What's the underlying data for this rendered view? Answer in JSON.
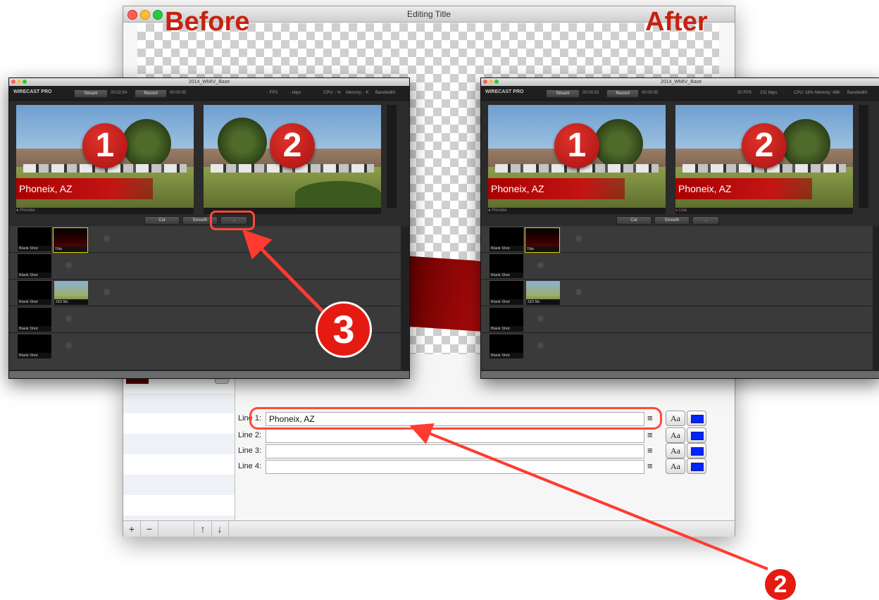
{
  "editing_window": {
    "title": "Editing Title",
    "before_label": "Before",
    "after_label": "After",
    "lines": [
      {
        "label": "Line 1:",
        "value": "Phoneix, AZ"
      },
      {
        "label": "Line 2:",
        "value": ""
      },
      {
        "label": "Line 3:",
        "value": ""
      },
      {
        "label": "Line 4:",
        "value": ""
      }
    ],
    "font_button": "Aa",
    "align_glyph": "≡",
    "color_swatch": "#0024ff",
    "bottom_buttons": {
      "add": "+",
      "remove": "−",
      "up": "↑",
      "down": "↓"
    }
  },
  "wirecast_left": {
    "title": "2014_WMIV_Base",
    "logo": "WIRECAST PRO",
    "stream_label": "Stream",
    "stream_time": "00:02:54",
    "record_label": "Record",
    "record_time": "00:00:00",
    "fps": "- FPS",
    "kbps": "- kbps",
    "cpu": "CPU: - %",
    "memory": "Memory: - K",
    "bandwidth": "Bandwidth:",
    "preview_num": "1",
    "live_num": "2",
    "lower_third": "Phoneix, AZ",
    "preview_label": "Preview",
    "live_label": "",
    "cut_label": "Cut",
    "smooth_label": "Smooth",
    "go_glyph": "→",
    "row_labels": [
      "Blank Shot",
      "Blank Shot",
      "Blank Shot",
      "Blank Shot",
      "Blank Shot"
    ],
    "title_shot": "Title",
    "sdi_shot": "SDI Mc"
  },
  "wirecast_right": {
    "title": "2014_WMIV_Base",
    "logo": "WIRECAST PRO",
    "stream_label": "Stream",
    "stream_time": "00:00:03",
    "record_label": "Record",
    "record_time": "00:00:00",
    "fps": "30 FPS",
    "kbps": "232 kbps",
    "cpu": "CPU: 16%",
    "memory": "Memory: 48K",
    "bandwidth": "Bandwidth:",
    "preview_num": "1",
    "live_num": "2",
    "lower_third": "Phoneix, AZ",
    "preview_label": "Preview",
    "live_label": "Live",
    "cut_label": "Cut",
    "smooth_label": "Smooth",
    "go_glyph": "→",
    "row_labels": [
      "Blank Shot",
      "Blank Shot",
      "Blank Shot",
      "Blank Shot",
      "Blank Shot"
    ],
    "title_shot": "Title",
    "sdi_shot": "SDI Mc"
  },
  "annotations": {
    "step3": "3",
    "step2": "2"
  }
}
